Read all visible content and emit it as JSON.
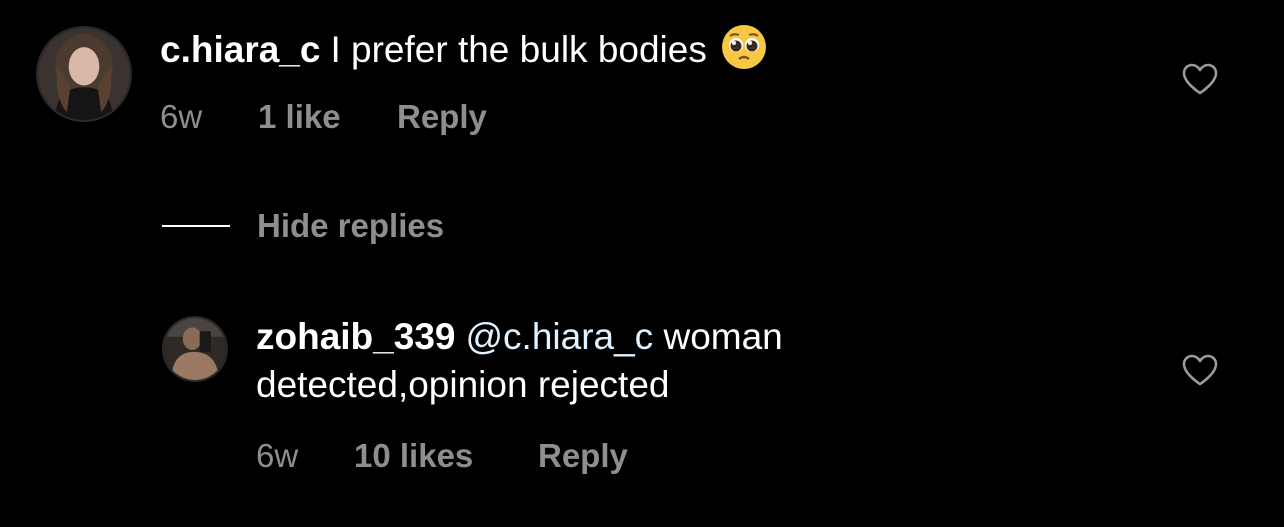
{
  "comments": [
    {
      "username": "c.hiara_c",
      "text": "I prefer the bulk bodies",
      "emoji": "pleading-face-emoji",
      "age": "6w",
      "likes": "1 like",
      "reply_label": "Reply"
    }
  ],
  "hide_replies_label": "Hide replies",
  "replies": [
    {
      "username": "zohaib_339",
      "mention": "@c.hiara_c",
      "text_line1": "woman",
      "text_line2": "detected,opinion rejected",
      "age": "6w",
      "likes": "10 likes",
      "reply_label": "Reply"
    }
  ],
  "icons": {
    "like": "heart-outline-icon"
  },
  "colors": {
    "background": "#000000",
    "text": "#ffffff",
    "secondary": "#8e8e8e",
    "mention": "#e0f1ff"
  }
}
